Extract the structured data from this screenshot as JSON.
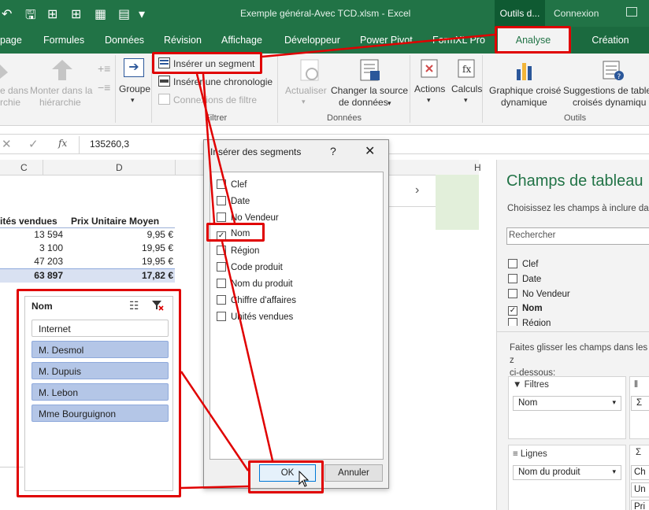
{
  "window": {
    "doc_title": "Exemple général-Avec TCD.xlsm  -  Excel",
    "context_tab": "Outils d...",
    "account": "Connexion"
  },
  "ribbon_tabs": [
    "page",
    "Formules",
    "Données",
    "Révision",
    "Affichage",
    "Développeur",
    "Power Pivot",
    "FormXL Pro",
    "Analyse",
    "Création"
  ],
  "ribbon": {
    "partial1_line1": "e dans",
    "partial1_line2": "rchie",
    "monter_line1": "Monter dans la",
    "monter_line2": "hiérarchie",
    "groupe": "Groupe",
    "inserer_segment": "Insérer un segment",
    "inserer_chronologie": "Insérer une chronologie",
    "connexions_filtre": "Connexions de filtre",
    "group_filtrer": "Filtrer",
    "actualiser": "Actualiser",
    "changer_line1": "Changer la source",
    "changer_line2": "de données",
    "group_donnees": "Données",
    "actions": "Actions",
    "calculs": "Calculs",
    "graph_line1": "Graphique croisé",
    "graph_line2": "dynamique",
    "sugg_line1": "Suggestions de table",
    "sugg_line2": "croisés dynamiqu",
    "group_outils": "Outils"
  },
  "formula_bar": {
    "value": "135260,3"
  },
  "sheet": {
    "col_c": "C",
    "col_d": "D",
    "col_h": "H",
    "headers": [
      "ités vendues",
      "Prix Unitaire Moyen"
    ],
    "rows": [
      [
        "13 594",
        "9,95 €"
      ],
      [
        "3 100",
        "19,95 €"
      ],
      [
        "47 203",
        "19,95 €"
      ]
    ],
    "total": [
      "63 897",
      "17,82 €"
    ]
  },
  "slicer": {
    "title": "Nom",
    "items": [
      "Internet",
      "M. Desmol",
      "M. Dupuis",
      "M. Lebon",
      "Mme Bourguignon"
    ]
  },
  "dialog": {
    "title": "Insérer des segments",
    "help": "?",
    "fields": [
      "Clef",
      "Date",
      "No Vendeur",
      "Nom",
      "Région",
      "Code produit",
      "Nom du produit",
      "Chiffre d'affaires",
      "Unités vendues"
    ],
    "checked_index": 3,
    "ok": "OK",
    "cancel": "Annuler"
  },
  "pane": {
    "title": "Champs de tableau",
    "subtitle": "Choisissez les champs à inclure da",
    "search_placeholder": "Rechercher",
    "fields": [
      "Clef",
      "Date",
      "No Vendeur",
      "Nom",
      "Région"
    ],
    "hint_line1": "Faites glisser les champs dans les z",
    "hint_line2": "ci-dessous:",
    "filtres_label": "Filtres",
    "filtres_value": "Nom",
    "sigma_value": "Σ",
    "lignes_label": "Lignes",
    "lignes_value": "Nom du produit",
    "values_partial": [
      "Ch",
      "Un",
      "Pri"
    ]
  },
  "colors": {
    "excel_green": "#217346",
    "annotation_red": "#e00000",
    "slicer_selected": "#b4c6e7"
  }
}
